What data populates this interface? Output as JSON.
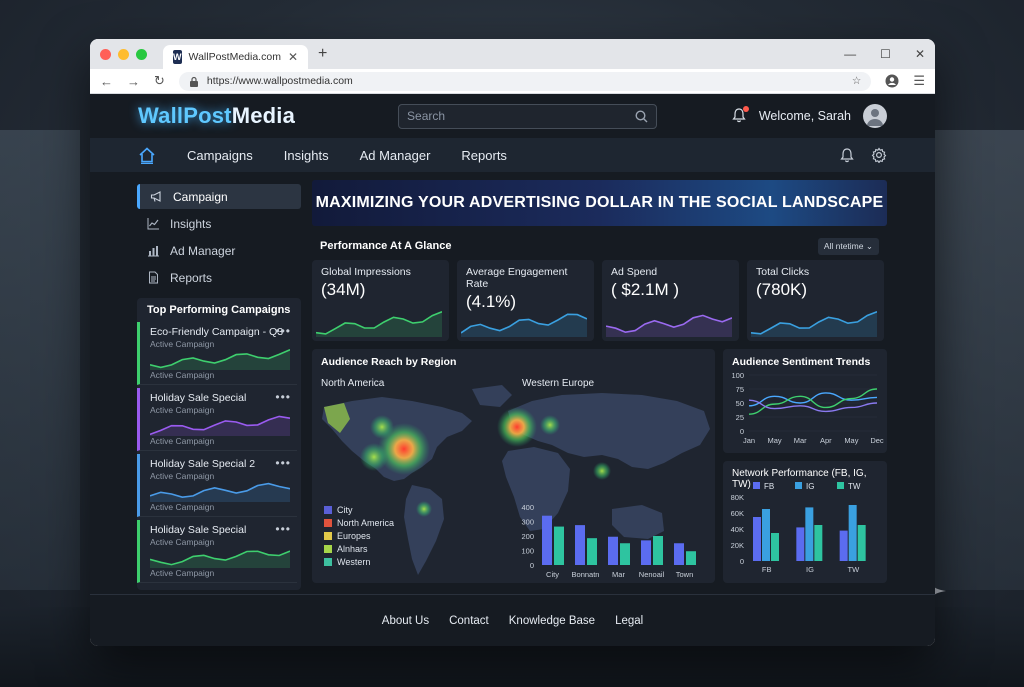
{
  "browser": {
    "tab_title": "WallPostMedia.com",
    "favicon_letter": "W",
    "url": "https://www.wallpostmedia.com"
  },
  "header": {
    "logo_a": "WallPost",
    "logo_b": "Media",
    "search_placeholder": "Search",
    "welcome": "Welcome, Sarah"
  },
  "nav": {
    "items": [
      "Campaigns",
      "Insights",
      "Ad Manager",
      "Reports"
    ]
  },
  "sidebar": {
    "items": [
      {
        "label": "Campaign",
        "icon": "megaphone-icon"
      },
      {
        "label": "Insights",
        "icon": "line-chart-icon"
      },
      {
        "label": "Ad Manager",
        "icon": "bar-chart-icon"
      },
      {
        "label": "Reports",
        "icon": "document-icon"
      }
    ],
    "top_title": "Top Performing Campaigns",
    "campaigns": [
      {
        "name": "Eco-Friendly Campaign - Q3",
        "sub": "Active Campaign",
        "sub2": "Active Campaign",
        "color": "#3ecf6e"
      },
      {
        "name": "Holiday Sale Special",
        "sub": "Active Campaign",
        "sub2": "Active Campaign",
        "color": "#9a5bf0"
      },
      {
        "name": "Holiday Sale Special 2",
        "sub": "Active Campaign",
        "sub2": "Active Campaign",
        "color": "#4a9be8"
      },
      {
        "name": "Holiday Sale Special",
        "sub": "Active Campaign",
        "sub2": "Active Campaign",
        "color": "#3ecf6e"
      }
    ]
  },
  "banner": "MAXIMIZING YOUR ADVERTISING DOLLAR IN THE SOCIAL LANDSCAPE",
  "performance": {
    "title": "Performance At A Glance",
    "filter": "All ntetime",
    "kpis": [
      {
        "label": "Global Impressions",
        "value": "(34M)",
        "color": "#3ecf6e"
      },
      {
        "label": "Average Engagement Rate",
        "value": "(4.1%)",
        "color": "#3aa0e0"
      },
      {
        "label": "Ad Spend",
        "value": "( $2.1M )",
        "color": "#9a6af0"
      },
      {
        "label": "Total Clicks",
        "value": "(780K)",
        "color": "#3aa0e0"
      }
    ]
  },
  "map": {
    "title": "Audience Reach by Region",
    "label_na": "North America",
    "label_eu": "Western Europe",
    "legend": [
      {
        "label": "City",
        "color": "#5a5fd6"
      },
      {
        "label": "North America",
        "color": "#e0533d"
      },
      {
        "label": "Europes",
        "color": "#e2c94a"
      },
      {
        "label": "Alnhars",
        "color": "#a6d64a"
      },
      {
        "label": "Western",
        "color": "#3ec0a0"
      }
    ]
  },
  "chart_data": [
    {
      "type": "bar",
      "categories": [
        "City",
        "Bonnatn",
        "Mar",
        "Nenoail",
        "Town"
      ],
      "series": [
        {
          "values": [
            340,
            275,
            195,
            170,
            150
          ]
        },
        {
          "values": [
            265,
            185,
            150,
            200,
            95
          ]
        }
      ],
      "ylim": [
        0,
        400
      ],
      "yticks": [
        0,
        100,
        200,
        300,
        400
      ],
      "colors": [
        "#5b6cf0",
        "#2ec4a0"
      ]
    },
    {
      "type": "line",
      "title": "Audience Sentiment Trends",
      "categories": [
        "Jan",
        "May",
        "Mar",
        "Apr",
        "May",
        "Dec"
      ],
      "series": [
        {
          "values": [
            45,
            62,
            50,
            68,
            55,
            60
          ],
          "color": "#4aa8ff"
        },
        {
          "values": [
            30,
            48,
            62,
            42,
            58,
            75
          ],
          "color": "#3ecf6e"
        },
        {
          "values": [
            55,
            40,
            45,
            35,
            42,
            50
          ],
          "color": "#8a7af0"
        }
      ],
      "ylim": [
        0,
        100
      ],
      "yticks": [
        0,
        25,
        50,
        75,
        100
      ]
    },
    {
      "type": "bar",
      "title": "Network Performance (FB, IG, TW)",
      "categories": [
        "FB",
        "IG",
        "TW"
      ],
      "series": [
        {
          "name": "FB",
          "values": [
            55000,
            42000,
            38000
          ],
          "color": "#5b6cf0"
        },
        {
          "name": "IG",
          "values": [
            65000,
            67000,
            70000
          ],
          "color": "#3aa0e0"
        },
        {
          "name": "TW",
          "values": [
            35000,
            45000,
            45000
          ],
          "color": "#2ec4a0"
        }
      ],
      "ylim": [
        0,
        80000
      ],
      "yticks": [
        "0",
        "20K",
        "40K",
        "60K",
        "80K"
      ]
    }
  ],
  "footer": {
    "links": [
      "About Us",
      "Contact",
      "Knowledge Base",
      "Legal"
    ]
  }
}
